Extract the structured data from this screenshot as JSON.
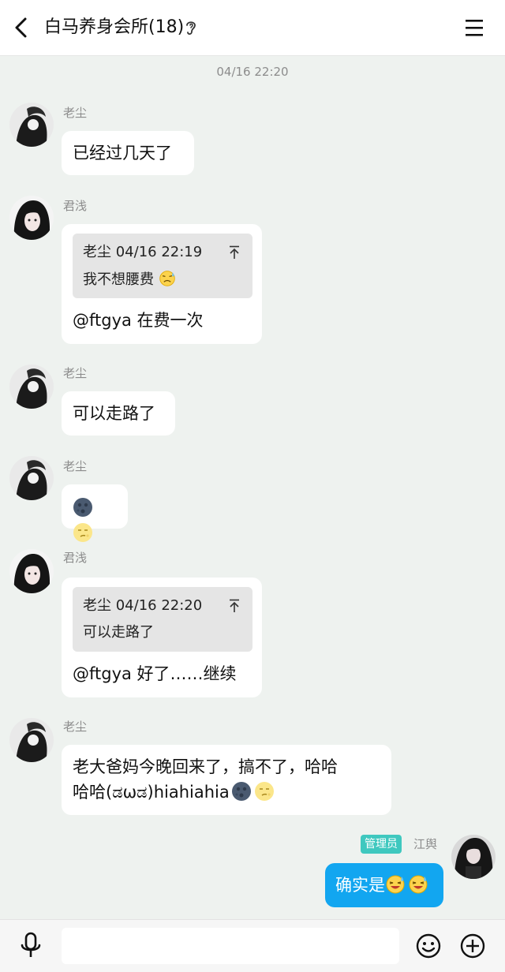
{
  "header": {
    "title": "白马养身会所(18)",
    "back_icon": "chevron-left-icon",
    "ear_icon": "ear-icon",
    "menu_icon": "hamburger-menu-icon"
  },
  "timestamp": "04/16 22:20",
  "messages": [
    {
      "nick": "老尘",
      "text": "已经过几天了"
    },
    {
      "nick": "君浅",
      "quote_head": "老尘 04/16 22:19",
      "quote_text": "我不想腰费",
      "text": "@ftgya 在费一次"
    },
    {
      "nick": "老尘",
      "text": "可以走路了"
    },
    {
      "nick": "老尘",
      "emojis": [
        "dark-moon-face-emoji",
        "moon-face-emoji"
      ]
    },
    {
      "nick": "君浅",
      "quote_head": "老尘 04/16 22:20",
      "quote_text": "可以走路了",
      "text": "@ftgya 好了……继续"
    },
    {
      "nick": "老尘",
      "line1": "老大爸妈今晚回来了，搞不了，哈哈",
      "line2": "哈哈(ಡωಡ)hiahiahia"
    }
  ],
  "self": {
    "badge": "管理员",
    "nick": "江舆",
    "text": "确实是"
  },
  "input": {
    "placeholder": "",
    "value": ""
  },
  "colors": {
    "background": "#eef2ef",
    "self_bubble": "#12a6f0",
    "admin_badge": "#3fc8bf",
    "quote_bg": "#e5e5e5"
  }
}
